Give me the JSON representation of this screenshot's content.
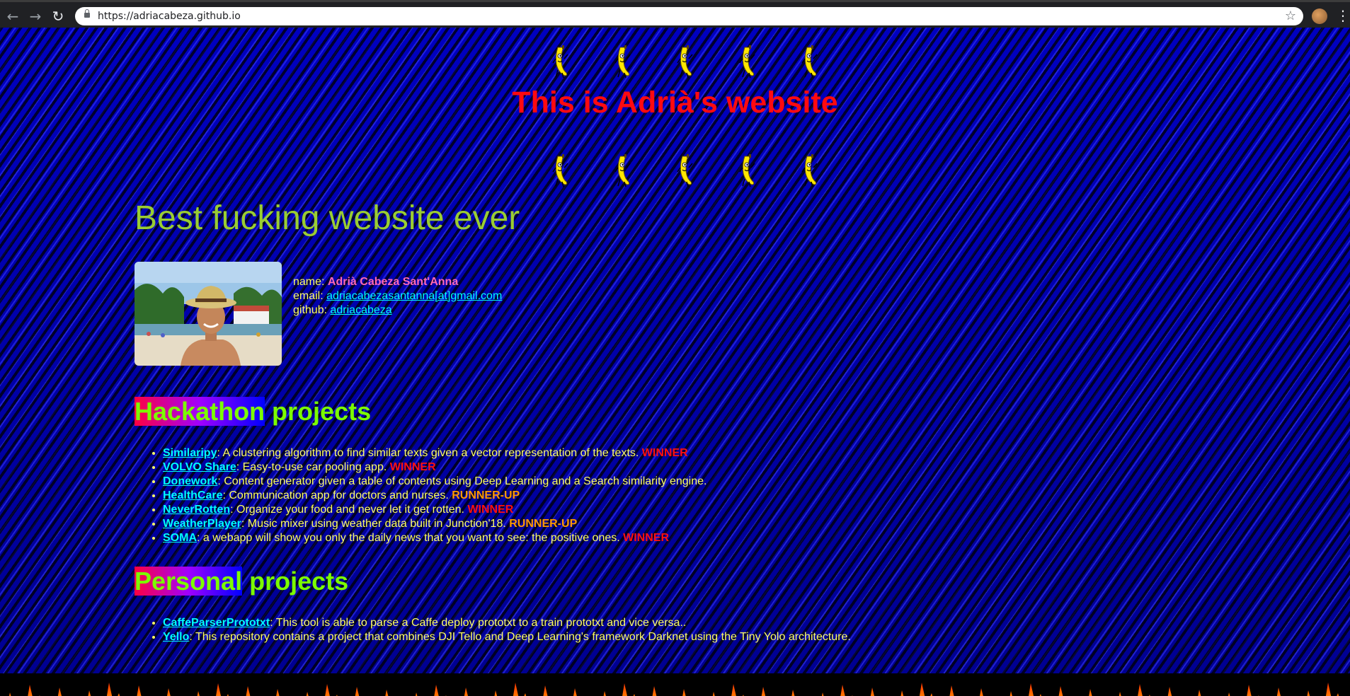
{
  "browser": {
    "url": "https://adriacabeza.github.io",
    "back_icon": "←",
    "forward_icon": "→",
    "reload_icon": "↻",
    "star_icon": "☆",
    "menu_icon": "⋮"
  },
  "page": {
    "title": "This is Adrià's website",
    "headline": "Best fucking website ever",
    "profile": {
      "name_label": "name: ",
      "name_value": "Adrià Cabeza Sant'Anna",
      "email_label": "email: ",
      "email_value": "adriacabezasantanna[at]gmail.com",
      "github_label": "github: ",
      "github_value": "adriacabeza"
    },
    "hackathon": {
      "title_highlight": "Hackathon",
      "title_rest": " projects",
      "items": [
        {
          "name": "Similaripy",
          "desc": ": A clustering algorithm to find similar texts given a vector representation of the texts. ",
          "award": "WINNER",
          "award_type": "winner"
        },
        {
          "name": "VOLVO Share",
          "desc": ": Easy-to-use car pooling app. ",
          "award": "WINNER",
          "award_type": "winner"
        },
        {
          "name": "Donework",
          "desc": ": Content generator given a table of contents using Deep Learning and a Search similarity engine.",
          "award": "",
          "award_type": ""
        },
        {
          "name": "HealthCare",
          "desc": ": Communication app for doctors and nurses. ",
          "award": "RUNNER-UP",
          "award_type": "runner"
        },
        {
          "name": "NeverRotten",
          "desc": ": Organize your food and never let it get rotten. ",
          "award": "WINNER",
          "award_type": "winner"
        },
        {
          "name": "WeatherPlayer",
          "desc": ": Music mixer using weather data built in Junction'18. ",
          "award": "RUNNER-UP",
          "award_type": "runner"
        },
        {
          "name": "SOMA",
          "desc": ": a webapp will show you only the daily news that you want to see: the positive ones. ",
          "award": "WINNER",
          "award_type": "winner"
        }
      ]
    },
    "personal": {
      "title_highlight": "Personal",
      "title_rest": " projects",
      "items": [
        {
          "name": "CaffeParserPrototxt",
          "desc": ": This tool is able to parse a Caffe deploy prototxt to a train prototxt and vice versa.."
        },
        {
          "name": "Yello",
          "desc": ": This repository contains a project that combines DJI Tello and Deep Learning's framework Darknet using the Tiny Yolo architecture."
        }
      ]
    }
  },
  "colors": {
    "title": "#ff0a10",
    "headline": "#9acd32",
    "section_title": "#7cfc00",
    "body_text": "#ffff66",
    "link": "#00ffff",
    "winner": "#ff1010",
    "runner_up": "#ff9900",
    "name": "#ff69b4"
  }
}
